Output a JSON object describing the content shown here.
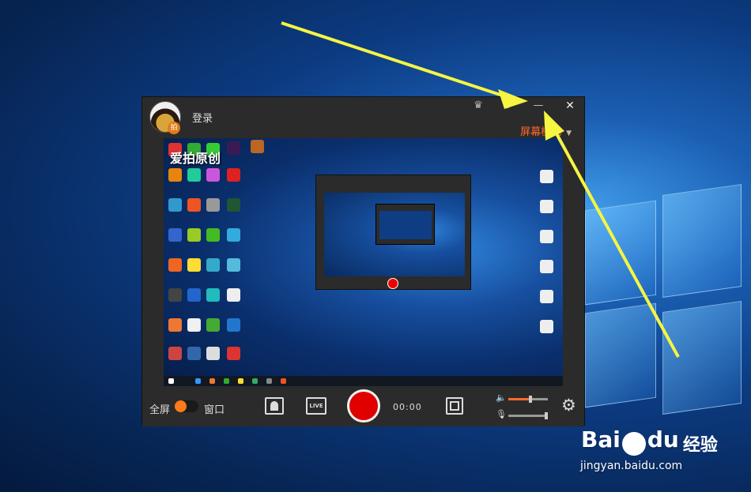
{
  "app": {
    "login_label": "登录",
    "mode_label": "屏幕模式",
    "avatar_badge": "拍"
  },
  "titlebar_icons": [
    "vip-icon",
    "help-icon",
    "minimize-icon",
    "close-icon"
  ],
  "titlebar_glyphs": {
    "vip": "♛",
    "help": "?",
    "minimize": "—",
    "close": "✕"
  },
  "preview": {
    "watermark": "爱拍原创"
  },
  "controls": {
    "fullscreen_label": "全屏",
    "window_label": "窗口",
    "live_label": "LIVE",
    "timer": "00:00",
    "volume_level": 0.55,
    "mic_level": 0.95
  },
  "baidu": {
    "logo_text": "Bai",
    "logo_text2": "du",
    "jingyan": "经验",
    "url": "jingyan.baidu.com"
  },
  "colors": {
    "accent": "#ff6a2a",
    "record": "#e00000",
    "annotation_arrow": "#f5f542"
  }
}
